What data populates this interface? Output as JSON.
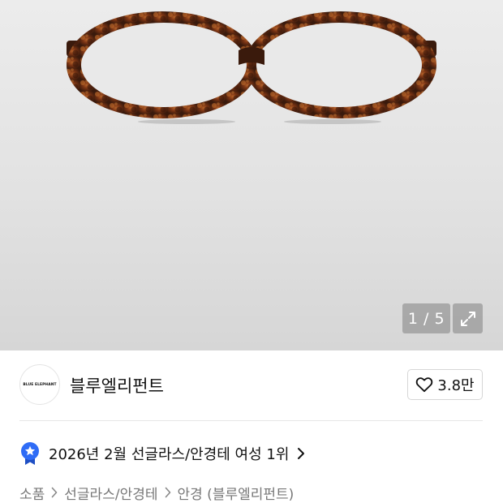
{
  "gallery": {
    "current_index": "1",
    "separator": " / ",
    "total": "5",
    "counter_text": "1 / 5"
  },
  "brand": {
    "logo_text": "BLUE ELEPHANT",
    "name": "블루엘리펀트",
    "like_count": "3.8만"
  },
  "ranking": {
    "text": "2026년 2월 선글라스/안경테 여성 1위"
  },
  "breadcrumb": {
    "items": [
      "소품",
      "선글라스/안경테",
      "안경 (블루엘리펀트)"
    ]
  },
  "colors": {
    "ranking_badge": "#2f6cf6",
    "tortoise_dark": "#3a1a0c",
    "tortoise_mid": "#7a3414",
    "tortoise_light": "#b5622a"
  }
}
